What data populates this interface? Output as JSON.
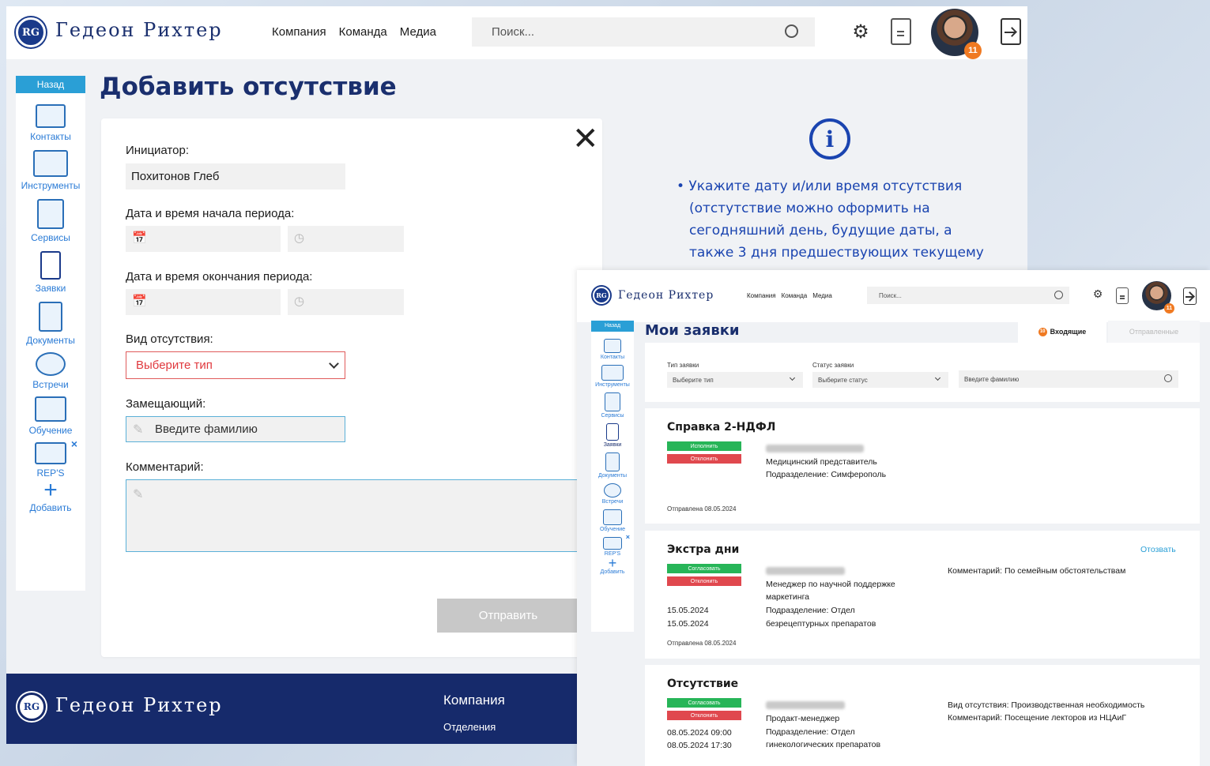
{
  "brand": {
    "logo_mark": "RG",
    "name": "Гедеон Рихтер",
    "color": "#1a3a8a"
  },
  "nav": {
    "items": [
      "Компания",
      "Команда",
      "Медиа"
    ]
  },
  "search": {
    "placeholder": "Поиск..."
  },
  "user": {
    "notifications": "11"
  },
  "sidebar": {
    "back_label": "Назад",
    "items": [
      {
        "label": "Контакты",
        "icon": "contacts-icon"
      },
      {
        "label": "Инструменты",
        "icon": "tools-icon"
      },
      {
        "label": "Сервисы",
        "icon": "services-icon"
      },
      {
        "label": "Заявки",
        "icon": "requests-icon"
      },
      {
        "label": "Документы",
        "icon": "documents-icon"
      },
      {
        "label": "Встречи",
        "icon": "meetings-icon"
      },
      {
        "label": "Обучение",
        "icon": "training-icon"
      },
      {
        "label": "REP'S",
        "icon": "reps-icon"
      },
      {
        "label": "Добавить",
        "icon": "plus-icon"
      }
    ]
  },
  "form": {
    "page_title": "Добавить отсутствие",
    "initiator_label": "Инициатор:",
    "initiator_value": "Похитонов Глеб",
    "start_label": "Дата и время начала периода:",
    "end_label": "Дата и время окончания периода:",
    "type_label": "Вид отсутствия:",
    "type_placeholder": "Выберите тип",
    "deputy_label": "Замещающий:",
    "deputy_placeholder": "Введите фамилию",
    "comment_label": "Комментарий:",
    "submit_label": "Отправить"
  },
  "info": {
    "lines": [
      "• Укажите дату и/или время отсутствия",
      "(отстутствие можно оформить на",
      "сегодняшний день, будущие даты, а",
      "также 3 дня предшествующих текущему"
    ]
  },
  "footer": {
    "heading": "Компания",
    "link": "Отделения"
  },
  "requests": {
    "page_title": "Мои заявки",
    "tabs": {
      "incoming_count": "10",
      "incoming": "Входящие",
      "sent": "Отправленные"
    },
    "filters": {
      "type_label": "Тип заявки",
      "type_placeholder": "Выберите тип",
      "status_label": "Статус заявки",
      "status_placeholder": "Выберите статус",
      "surname_placeholder": "Введите фамилию"
    },
    "cards": [
      {
        "title": "Справка 2-НДФЛ",
        "btn_green": "Исполнить",
        "btn_red": "Отклонить",
        "position": "Медицинский представитель",
        "department": "Подразделение: Симферополь",
        "sent": "Отправлена 08.05.2024"
      },
      {
        "title": "Экстра дни",
        "btn_green": "Согласовать",
        "btn_red": "Отклонить",
        "position_line1": "Менеджер по научной поддержке",
        "position_line2": "маркетинга",
        "department_line1": "Подразделение: Отдел",
        "department_line2": "безрецептурных препаратов",
        "date_from": "15.05.2024",
        "date_to": "15.05.2024",
        "comment": "Комментарий: По семейным обстоятельствам",
        "recall": "Отозвать",
        "sent": "Отправлена 08.05.2024"
      },
      {
        "title": "Отсутствие",
        "btn_green": "Согласовать",
        "btn_red": "Отклонить",
        "position": "Продакт-менеджер",
        "department_line1": "Подразделение: Отдел",
        "department_line2": "гинекологических препаратов",
        "date_from": "08.05.2024 09:00",
        "date_to": "08.05.2024 17:30",
        "absence_type": "Вид отсутствия: Производственная необходимость",
        "comment": "Комментарий: Посещение лекторов из НЦАиГ"
      }
    ]
  }
}
